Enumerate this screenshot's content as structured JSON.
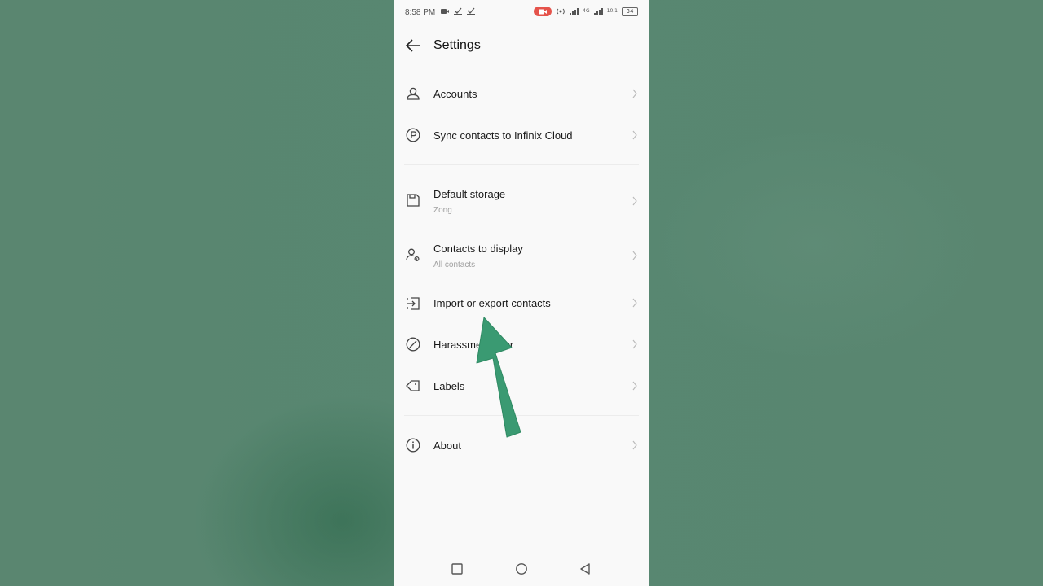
{
  "status_bar": {
    "time": "8:58 PM",
    "battery": "34",
    "network_label": "4G",
    "speed_label": "10.1"
  },
  "header": {
    "title": "Settings"
  },
  "settings_items": [
    {
      "label": "Accounts",
      "sub": ""
    },
    {
      "label": "Sync contacts to Infinix Cloud",
      "sub": ""
    },
    {
      "label": "Default storage",
      "sub": "Zong"
    },
    {
      "label": "Contacts to display",
      "sub": "All contacts"
    },
    {
      "label": "Import or export contacts",
      "sub": ""
    },
    {
      "label": "Harassment filter",
      "sub": ""
    },
    {
      "label": "Labels",
      "sub": ""
    },
    {
      "label": "About",
      "sub": ""
    }
  ],
  "colors": {
    "background": "#5a8670",
    "screen": "#f9f9f9",
    "arrow": "#3a9a72",
    "record_pill": "#e5534b"
  },
  "icons": {
    "back": "arrow-left-icon",
    "accounts": "person-icon",
    "sync": "cloud-p-icon",
    "storage": "save-icon",
    "display": "person-view-icon",
    "import_export": "import-icon",
    "harassment": "block-icon",
    "labels": "tag-icon",
    "about": "info-icon"
  }
}
